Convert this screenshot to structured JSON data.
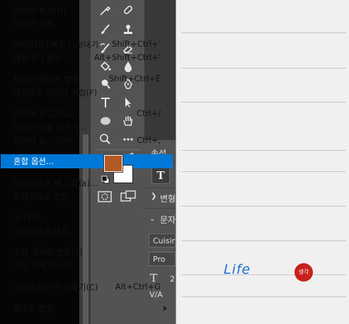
{
  "panel": {
    "tab_label": "속성",
    "transform_label": "변형",
    "char_label": "문자",
    "font_family": "Cuisine",
    "font_style": "Pro",
    "size_icon_label": "T",
    "va_label": "V/A"
  },
  "colors": {
    "foreground": "#b25a24",
    "background": "#ffffff",
    "highlight": "#0078d7"
  },
  "tools": [
    "eyedropper-icon",
    "spot-healing-icon",
    "brush-icon",
    "stamp-icon",
    "history-brush-icon",
    "eraser-icon",
    "paint-bucket-icon",
    "blur-icon",
    "dodge-icon",
    "pen-icon",
    "type-icon",
    "path-select-icon",
    "ellipse-icon",
    "hand-icon",
    "zoom-icon",
    "more-icon"
  ],
  "menu": {
    "items": [
      {
        "label": "레이어 복제(D)...",
        "shortcut": ""
      },
      {
        "label": "레이어 삭제",
        "shortcut": ""
      },
      {
        "label": "JPG으(로) 빠른 내보내기",
        "shortcut": "Shift+Ctrl+'"
      },
      {
        "label": "내보내기 형식...",
        "shortcut": "Alt+Shift+Ctrl+'"
      },
      {
        "label": "보이는 레이어 병합",
        "shortcut": "Shift+Ctrl+E"
      },
      {
        "label": "배경으로 이미지 병합(F)",
        "shortcut": ""
      },
      {
        "label": "레이어 잠그기(L)...",
        "shortcut": "Ctrl+/"
      },
      {
        "label": "레이어 이름 바꾸기...",
        "shortcut": ""
      },
      {
        "label": "레이어 숨기기(R)",
        "shortcut": "Ctrl+,"
      },
      {
        "label": "혼합 옵션...",
        "shortcut": ""
      },
      {
        "label": "레이어에서 새 그룹(a)...",
        "shortcut": ""
      },
      {
        "label": "프레임으로 변환",
        "shortcut": ""
      },
      {
        "label": "새 대지...",
        "shortcut": ""
      },
      {
        "label": "레이어에서 대지...",
        "shortcut": ""
      },
      {
        "label": "고급 개체로 변환(S)",
        "shortcut": ""
      },
      {
        "label": "모든 개체 마스크",
        "shortcut": ""
      },
      {
        "label": "클리핑 마스크 만들기(C)",
        "shortcut": "Alt+Ctrl+G"
      },
      {
        "label": "텍스트 방향",
        "shortcut": ""
      }
    ]
  },
  "watermark": {
    "text": "Life",
    "seal": "생각"
  }
}
